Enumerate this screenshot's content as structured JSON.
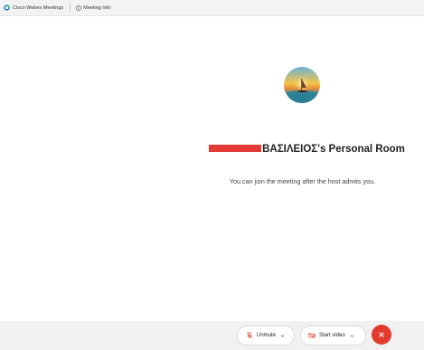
{
  "topbar": {
    "app_title": "Cisco Webex Meetings",
    "meeting_info_label": "Meeting Info"
  },
  "room": {
    "host_name_visible": "ΒΑΣΙΛΕΙΟΣ",
    "title_suffix": "'s Personal Room",
    "join_message": "You can join the meeting after the host admits you."
  },
  "controls": {
    "unmute_label": "Unmute",
    "start_video_label": "Start video"
  },
  "colors": {
    "leave_button": "#e33b2e",
    "redaction": "#e23b35",
    "mic_accent": "#e0463a"
  },
  "icons": {
    "app_logo": "webex-logo-icon",
    "meeting_info": "info-icon",
    "unmute": "microphone-muted-icon",
    "start_video": "video-off-icon",
    "dropdown": "chevron-down-icon",
    "leave": "close-icon"
  }
}
